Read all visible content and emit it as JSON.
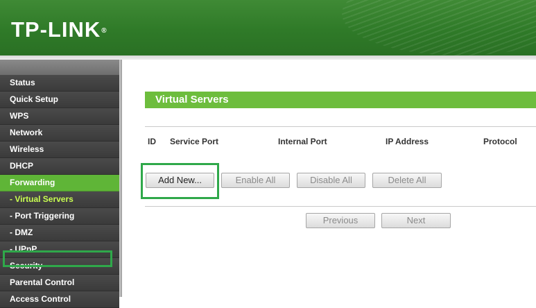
{
  "header": {
    "logo_text": "TP-LINK",
    "logo_mark": "®"
  },
  "sidebar": {
    "items": [
      {
        "label": "Status"
      },
      {
        "label": "Quick Setup"
      },
      {
        "label": "WPS"
      },
      {
        "label": "Network"
      },
      {
        "label": "Wireless"
      },
      {
        "label": "DHCP"
      },
      {
        "label": "Forwarding"
      },
      {
        "label": "- Virtual Servers"
      },
      {
        "label": "- Port Triggering"
      },
      {
        "label": "- DMZ"
      },
      {
        "label": "- UPnP"
      },
      {
        "label": "Security"
      },
      {
        "label": "Parental Control"
      },
      {
        "label": "Access Control"
      }
    ],
    "active_parent": "Forwarding",
    "active_item": "- Virtual Servers"
  },
  "main": {
    "title": "Virtual Servers",
    "columns": [
      "ID",
      "Service Port",
      "Internal Port",
      "IP Address",
      "Protocol"
    ],
    "buttons": {
      "add_new": "Add New...",
      "enable_all": "Enable All",
      "disable_all": "Disable All",
      "delete_all": "Delete All"
    },
    "pagination": {
      "previous": "Previous",
      "next": "Next"
    }
  },
  "colors": {
    "brand_green": "#2f7a28",
    "title_green": "#6dbd3d",
    "active_menu_green": "#5fb537",
    "active_sub_text": "#c8ff50",
    "highlight_green": "#2fa84a"
  }
}
